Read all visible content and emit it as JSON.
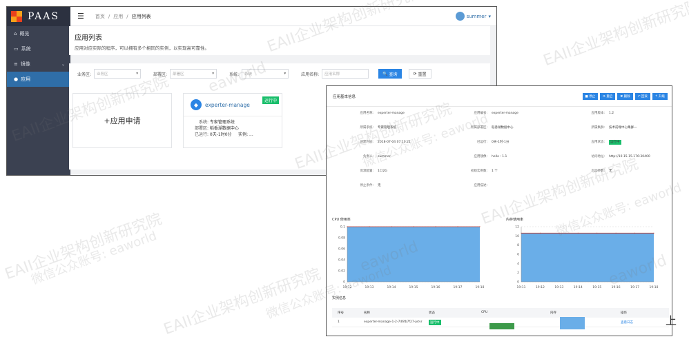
{
  "background_window": {
    "logo": "PAAS",
    "sidebar": {
      "items": [
        {
          "icon": "home-icon",
          "label": "概览",
          "active": false
        },
        {
          "icon": "monitor-icon",
          "label": "系统",
          "active": false
        },
        {
          "icon": "layers-icon",
          "label": "镜像",
          "active": false,
          "has_chevron": true
        },
        {
          "icon": "app-dot-icon",
          "label": "应用",
          "active": true
        }
      ]
    },
    "topbar": {
      "breadcrumb": [
        "首页",
        "应用",
        "应用列表"
      ],
      "user": "summer"
    },
    "page_header": {
      "title": "应用列表",
      "description": "应用对应实际的程序，可以拥有多个相同的实例，以实现高可靠性。"
    },
    "filters": [
      {
        "label": "业务区:",
        "placeholder": "业务区",
        "type": "select"
      },
      {
        "label": "部署区:",
        "placeholder": "部署区",
        "type": "select"
      },
      {
        "label": "系统:",
        "placeholder": "系统",
        "type": "select"
      },
      {
        "label": "应用名称:",
        "placeholder": "应用名称",
        "type": "input"
      }
    ],
    "query_button": "查询",
    "reset_button": "重置",
    "new_card_label": "+应用申请",
    "app_card": {
      "name": "experter-manage",
      "status": "运行中",
      "rows": [
        {
          "k": "系统:",
          "v": "专家管理系统"
        },
        {
          "k": "部署区:",
          "v": "稻香湖数据中心"
        },
        {
          "k": "已运行:",
          "v": "0天-1时0分"
        }
      ],
      "instances_label": "实例: ..."
    }
  },
  "detail_window": {
    "title": "应用基本信息",
    "actions": [
      "停止",
      "重启",
      "删除",
      "回滚",
      "升级"
    ],
    "info": [
      {
        "k": "应用名称:",
        "v": "experter-manage"
      },
      {
        "k": "应用编号:",
        "v": "experter-manage"
      },
      {
        "k": "应用版本:",
        "v": "1.2"
      },
      {
        "k": "所属系统:",
        "v": "专家管理系统"
      },
      {
        "k": "所属部署区:",
        "v": "稻香湖数据中心"
      },
      {
        "k": "所属集群:",
        "v": "技术前端中心集群一"
      },
      {
        "k": "创建时间:",
        "v": "2018-07-04 07:10:21"
      },
      {
        "k": "已运行:",
        "v": "0天-1时-1分"
      },
      {
        "k": "应用状态:",
        "v": "运行中"
      },
      {
        "k": "负责人:",
        "v": "summer"
      },
      {
        "k": "应用镜像:",
        "v": "hello : 1.1"
      },
      {
        "k": "访问地址:",
        "v": "http://10.15.15.176:30400"
      },
      {
        "k": "资源配置:",
        "v": "1C/2G"
      },
      {
        "k": "初始实例数:",
        "v": "1 个"
      },
      {
        "k": "启动参数:",
        "v": "无"
      },
      {
        "k": "停止条件:",
        "v": "无"
      },
      {
        "k": "应用描述:",
        "v": ""
      }
    ],
    "cpu_title": "CPU 使用率",
    "mem_title": "内存使用率",
    "instances_title": "实例信息",
    "table_headers": [
      "序号",
      "名称",
      "状态",
      "CPU",
      "内存",
      "操作"
    ],
    "table_rows": [
      {
        "idx": "1",
        "name": "experter-manage-1-2-7d6fb7f27-jvtvr",
        "status": "运行中",
        "cpu_frac": 0.6,
        "mem_frac": 0.6,
        "action": "查看日志"
      }
    ]
  },
  "chart_data": [
    {
      "type": "area",
      "title": "CPU 使用率",
      "x": [
        "19:12",
        "19:13",
        "19:14",
        "19:15",
        "19:16",
        "19:17",
        "19:18"
      ],
      "y_ticks": [
        "0",
        "0.02",
        "0.04",
        "0.06",
        "0.08",
        "0.1"
      ],
      "values": [
        0.1,
        0.1,
        0.1,
        0.1,
        0.1,
        0.1,
        0.1
      ],
      "ylim": [
        0,
        0.1
      ],
      "fill": "#6aaee8",
      "line": "#c0392b"
    },
    {
      "type": "area",
      "title": "内存使用率",
      "x": [
        "19:11",
        "19:12",
        "19:13",
        "19:14",
        "19:15",
        "19:16",
        "19:17",
        "19:18"
      ],
      "y_ticks": [
        "0",
        "2",
        "4",
        "6",
        "8",
        "10",
        "12"
      ],
      "values": [
        10.6,
        10.6,
        10.6,
        10.6,
        10.6,
        10.6,
        10.6,
        10.6
      ],
      "ylim": [
        0,
        12
      ],
      "fill": "#6aaee8",
      "line": "#c0392b"
    }
  ],
  "watermarks": [
    "EAII企业架构创新研究院",
    "微信公众账号: eaworld",
    "eaworld"
  ],
  "corner_char": "上"
}
